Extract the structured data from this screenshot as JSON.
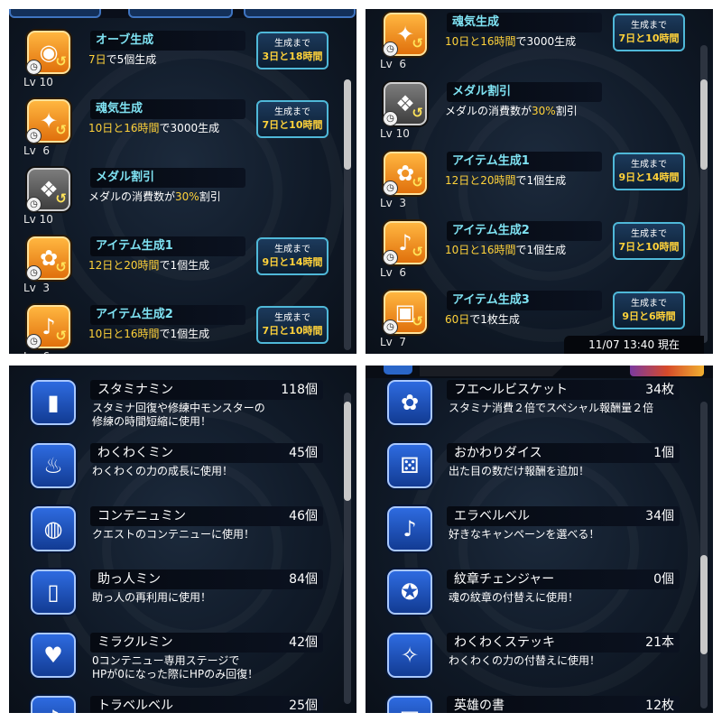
{
  "panel1": {
    "rows": [
      {
        "title": "オーブ生成",
        "lv": "Lv 10",
        "desc": [
          {
            "t": "7日",
            "h": true
          },
          {
            "t": "で5個生成",
            "h": false
          }
        ],
        "timer_label": "生成まで",
        "timer_value": "3日と18時間",
        "icon": "rainbow-orb-icon",
        "glyph": "◉"
      },
      {
        "title": "魂気生成",
        "lv": "Lv  6",
        "desc": [
          {
            "t": "10日と16時間",
            "h": true
          },
          {
            "t": "で3000生成",
            "h": false
          }
        ],
        "timer_label": "生成まで",
        "timer_value": "7日と10時間",
        "icon": "blue-spirit-icon",
        "glyph": "✦"
      },
      {
        "title": "メダル割引",
        "lv": "Lv 10",
        "desc": [
          {
            "t": "メダルの消費数が",
            "h": false
          },
          {
            "t": "30%",
            "h": true
          },
          {
            "t": "割引",
            "h": false
          }
        ],
        "timer_label": "",
        "timer_value": "",
        "icon": "medal-tag-icon",
        "glyph": "❖"
      },
      {
        "title": "アイテム生成1",
        "lv": "Lv  3",
        "desc": [
          {
            "t": "12日と20時間",
            "h": true
          },
          {
            "t": "で1個生成",
            "h": false
          }
        ],
        "timer_label": "生成まで",
        "timer_value": "9日と14時間",
        "icon": "biscuit-icon",
        "glyph": "✿"
      },
      {
        "title": "アイテム生成2",
        "lv": "Lv  6",
        "desc": [
          {
            "t": "10日と16時間",
            "h": true
          },
          {
            "t": "で1個生成",
            "h": false
          }
        ],
        "timer_label": "生成まで",
        "timer_value": "7日と10時間",
        "icon": "bell-item-icon",
        "glyph": "♪"
      }
    ]
  },
  "panel2": {
    "rows": [
      {
        "title": "魂気生成",
        "lv": "Lv  6",
        "desc": [
          {
            "t": "10日と16時間",
            "h": true
          },
          {
            "t": "で3000生成",
            "h": false
          }
        ],
        "timer_label": "生成まで",
        "timer_value": "7日と10時間",
        "icon": "blue-spirit-icon",
        "glyph": "✦"
      },
      {
        "title": "メダル割引",
        "lv": "Lv 10",
        "desc": [
          {
            "t": "メダルの消費数が",
            "h": false
          },
          {
            "t": "30%",
            "h": true
          },
          {
            "t": "割引",
            "h": false
          }
        ],
        "timer_label": "",
        "timer_value": "",
        "icon": "medal-tag-icon",
        "glyph": "❖"
      },
      {
        "title": "アイテム生成1",
        "lv": "Lv  3",
        "desc": [
          {
            "t": "12日と20時間",
            "h": true
          },
          {
            "t": "で1個生成",
            "h": false
          }
        ],
        "timer_label": "生成まで",
        "timer_value": "9日と14時間",
        "icon": "biscuit-icon",
        "glyph": "✿"
      },
      {
        "title": "アイテム生成2",
        "lv": "Lv  6",
        "desc": [
          {
            "t": "10日と16時間",
            "h": true
          },
          {
            "t": "で1個生成",
            "h": false
          }
        ],
        "timer_label": "生成まで",
        "timer_value": "7日と10時間",
        "icon": "bell-item-icon",
        "glyph": "♪"
      },
      {
        "title": "アイテム生成3",
        "lv": "Lv  7",
        "desc": [
          {
            "t": "60日",
            "h": true
          },
          {
            "t": "で1枚生成",
            "h": false
          }
        ],
        "timer_label": "生成まで",
        "timer_value": "9日と6時間",
        "icon": "card-item-icon",
        "glyph": "▣"
      }
    ],
    "timestamp": "11/07 13:40 現在"
  },
  "panel3": {
    "items": [
      {
        "name": "スタミナミン",
        "count": "118個",
        "desc": [
          "スタミナ回復や修練中モンスターの",
          "修練の時間短縮に使用！"
        ],
        "icon": "stamina-drink-icon",
        "glyph": "▮"
      },
      {
        "name": "わくわくミン",
        "count": "45個",
        "desc": [
          "わくわくの力の成長に使用！"
        ],
        "icon": "waku-bottle-icon",
        "glyph": "♨"
      },
      {
        "name": "コンテニュミン",
        "count": "46個",
        "desc": [
          "クエストのコンテニューに使用！"
        ],
        "icon": "continue-potion-icon",
        "glyph": "◍"
      },
      {
        "name": "助っ人ミン",
        "count": "84個",
        "desc": [
          "助っ人の再利用に使用！"
        ],
        "icon": "helper-bottle-icon",
        "glyph": "▯"
      },
      {
        "name": "ミラクルミン",
        "count": "42個",
        "desc": [
          "0コンテニュー専用ステージで",
          "HPが0になった際にHPのみ回復！"
        ],
        "icon": "miracle-heart-icon",
        "glyph": "♥"
      },
      {
        "name": "トラベルベル",
        "count": "25個",
        "desc": [],
        "icon": "travel-bell-icon",
        "glyph": "♪"
      }
    ]
  },
  "panel4": {
    "items": [
      {
        "name": "フエ～ルビスケット",
        "count": "34枚",
        "desc": [
          "スタミナ消費２倍でスペシャル報酬量２倍"
        ],
        "icon": "biscuit-icon",
        "glyph": "✿"
      },
      {
        "name": "おかわりダイス",
        "count": "1個",
        "desc": [
          "出た目の数だけ報酬を追加！"
        ],
        "icon": "dice-icon",
        "glyph": "⚄"
      },
      {
        "name": "エラベルベル",
        "count": "34個",
        "desc": [
          "好きなキャンペーンを選べる！"
        ],
        "icon": "select-bell-icon",
        "glyph": "♪"
      },
      {
        "name": "紋章チェンジャー",
        "count": "0個",
        "desc": [
          "魂の紋章の付替えに使用！"
        ],
        "icon": "emblem-changer-icon",
        "glyph": "✪"
      },
      {
        "name": "わくわくステッキ",
        "count": "21本",
        "desc": [
          "わくわくの力の付替えに使用！"
        ],
        "icon": "waku-stick-icon",
        "glyph": "✧"
      },
      {
        "name": "英雄の書",
        "count": "12枚",
        "desc": [],
        "icon": "hero-book-icon",
        "glyph": "▤"
      }
    ]
  }
}
